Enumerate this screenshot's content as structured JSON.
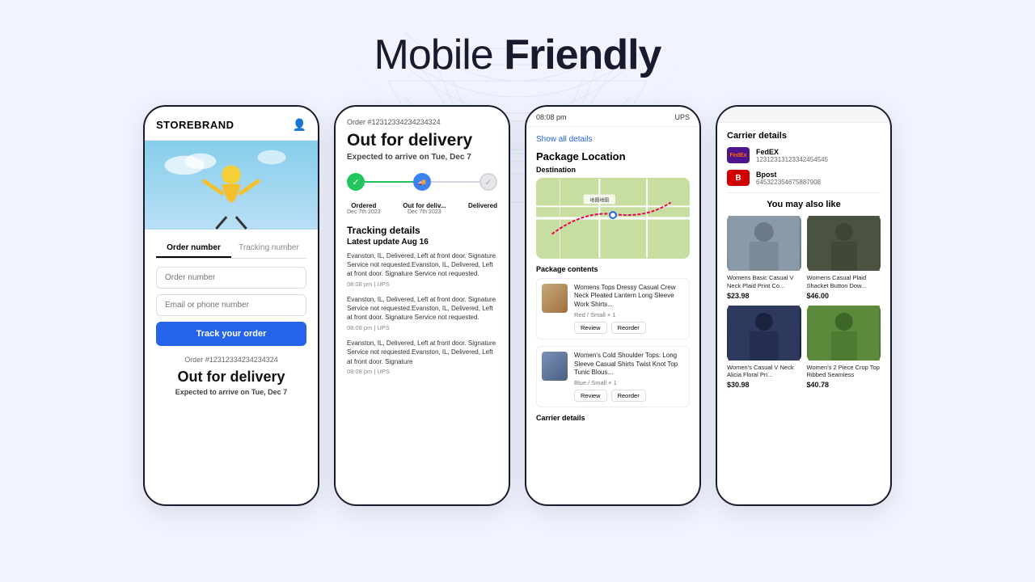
{
  "header": {
    "title_regular": "Mobile ",
    "title_bold": "Friendly"
  },
  "phone1": {
    "brand": "STOREBRAND",
    "tab_order": "Order number",
    "tab_tracking": "Tracking number",
    "input_order_placeholder": "Order number",
    "input_email_placeholder": "Email or phone number",
    "btn_track": "Track your order",
    "order_number": "Order #12312334234234324",
    "status": "Out for delivery",
    "eta_prefix": "Expected to arrive on ",
    "eta_date": "Tue, Dec 7"
  },
  "phone2": {
    "order_label": "Order #12312334234234324",
    "status": "Out for delivery",
    "eta_prefix": "Expected to arrive on ",
    "eta_date": "Tue, Dec 7",
    "steps": [
      {
        "name": "Ordered",
        "date": "Dec 7th 2023",
        "state": "done"
      },
      {
        "name": "Out for deliv...",
        "date": "Dec 7th 2023",
        "state": "active"
      },
      {
        "name": "Delivered",
        "date": "",
        "state": "pending"
      }
    ],
    "tracking_title": "Tracking details",
    "latest_update": "Latest update Aug 16",
    "events": [
      {
        "text": "Evanston, IL, Delivered, Left at front door. Signature Service not requested.Evanston, IL, Delivered, Left at front door. Signature Service not requested.",
        "meta": "08:08 pm | UPS"
      },
      {
        "text": "Evanston, IL, Delivered, Left at front door. Signature Service not requested.Evanston, IL, Delivered, Left at front door. Signature Service not requested.",
        "meta": "08:08 pm | UPS"
      },
      {
        "text": "Evanston, IL, Delivered, Left at front door. Signature Service not requested.Evanston, IL, Delivered, Left at front door. Signature",
        "meta": "08:08 pm | UPS"
      }
    ]
  },
  "phone3": {
    "topbar_time": "08:08 pm",
    "topbar_carrier": "UPS",
    "show_all": "Show all details",
    "pkg_location": "Package Location",
    "destination": "Destination",
    "pkg_contents": "Package contents",
    "carrier_details": "Carrier details",
    "items": [
      {
        "name": "Womens Tops Dressy Casual Crew Neck Pleated Lantern Long Sleeve Work Shirts...",
        "variant": "Red / Small  × 1",
        "btn1": "Review",
        "btn2": "Reorder",
        "color": "brown"
      },
      {
        "name": "Women's Cold Shoulder Tops: Long Sleeve Casual Shirts Twist Knot Top Tunic Blous...",
        "variant": "Blue / Small  × 1",
        "btn1": "Review",
        "btn2": "Reorder",
        "color": "blue"
      }
    ]
  },
  "phone4": {
    "carrier_details_title": "Carrier details",
    "carriers": [
      {
        "name": "FedEX",
        "tracking": "12312313123342454545",
        "logo": "FedEx",
        "type": "fedex"
      },
      {
        "name": "Bpost",
        "tracking": "645322354675887908",
        "logo": "B",
        "type": "bpost"
      }
    ],
    "also_like": "You may also like",
    "products": [
      {
        "name": "Womens Basic Casual V Neck Plaid Print Co...",
        "price": "$23.98",
        "color": "gray"
      },
      {
        "name": "Womens Casual Plaid Shacket Button Dow...",
        "price": "$46.00",
        "color": "olive"
      },
      {
        "name": "Women's Casual V Neck Alicia Floral Pri...",
        "price": "$30.98",
        "color": "darkblue"
      },
      {
        "name": "Women's 2 Piece Crop Top Ribbed Seamless",
        "price": "$40.78",
        "color": "green"
      }
    ]
  }
}
